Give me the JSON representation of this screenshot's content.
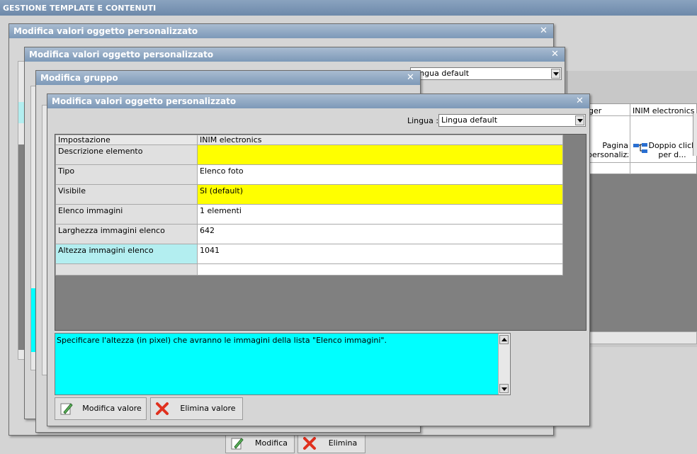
{
  "app": {
    "title": "GESTIONE TEMPLATE E CONTENUTI"
  },
  "background": {
    "col_manager": "ger",
    "col_inim": "INIM electronics",
    "cell_pagina": "Pagina personalizz...",
    "cell_doppio": "Doppio click per d...",
    "modifica_label": "Modifica",
    "elimina_label": "Elimina"
  },
  "dialog1": {
    "title": "Modifica valori oggetto personalizzato"
  },
  "dialog2": {
    "title": "Modifica valori oggetto personalizzato",
    "lingua_value": "Lingua default"
  },
  "dialog3": {
    "title": "Modifica gruppo"
  },
  "dialog4": {
    "title": "Modifica valori oggetto personalizzato",
    "lingua_label": "Lingua :",
    "lingua_value": "Lingua default",
    "grid": {
      "headers": [
        "Impostazione",
        "INIM electronics"
      ],
      "rows": [
        {
          "name": "Descrizione elemento",
          "value": "",
          "highlight": "yellow"
        },
        {
          "name": "Tipo",
          "value": "Elenco foto",
          "highlight": "none"
        },
        {
          "name": "Visibile",
          "value": "SI (default)",
          "highlight": "yellow"
        },
        {
          "name": "Elenco immagini",
          "value": "1 elementi",
          "highlight": "none"
        },
        {
          "name": "Larghezza immagini elenco",
          "value": "642",
          "highlight": "none"
        },
        {
          "name": "Altezza immagini elenco",
          "value": "1041",
          "highlight": "selected"
        },
        {
          "name": "",
          "value": "",
          "highlight": "none"
        }
      ]
    },
    "description": "Specificare l'altezza (in pixel) che avranno le immagini della lista \"Elenco immagini\".",
    "buttons": {
      "modifica": "Modifica valore",
      "elimina": "Elimina valore"
    }
  },
  "colors": {
    "yellow": "#ffff00",
    "cyan": "#00ffff",
    "selected": "#b3eef0",
    "title": "#7d99b8"
  }
}
